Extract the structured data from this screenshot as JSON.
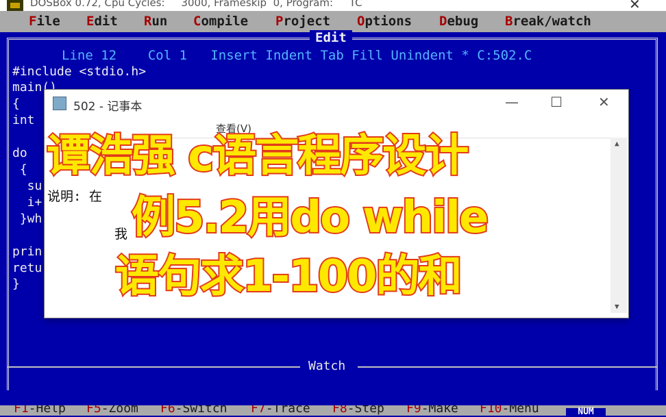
{
  "host_window": {
    "title": "DOSBox 0.72, Cpu Cycles:     3000, Frameskip  0, Program:     TC",
    "close_glyph": "✕"
  },
  "menubar": {
    "items": [
      {
        "hot": "F",
        "rest": "ile"
      },
      {
        "hot": "E",
        "rest": "dit"
      },
      {
        "hot": "R",
        "rest": "un"
      },
      {
        "hot": "C",
        "rest": "ompile"
      },
      {
        "hot": "P",
        "rest": "roject"
      },
      {
        "hot": "O",
        "rest": "ptions"
      },
      {
        "hot": "D",
        "rest": "ebug"
      },
      {
        "hot": "B",
        "rest": "reak/watch"
      }
    ]
  },
  "editor": {
    "title": "Edit",
    "status": "Line 12    Col 1   Insert Indent Tab Fill Unindent * C:502.C",
    "code_lines": [
      "#include <stdio.h>",
      "main()",
      "{",
      "int",
      "",
      "do",
      " {",
      "  su",
      "  i+",
      " }wh",
      "",
      "prin",
      "retu",
      "}"
    ],
    "watch_label": "Watch"
  },
  "fkeys": [
    {
      "key": "F1",
      "label": "-Help"
    },
    {
      "key": "F5",
      "label": "-Zoom"
    },
    {
      "key": "F6",
      "label": "-Switch"
    },
    {
      "key": "F7",
      "label": "-Trace"
    },
    {
      "key": "F8",
      "label": "-Step"
    },
    {
      "key": "F9",
      "label": "-Make"
    },
    {
      "key": "F10",
      "label": "-Menu"
    }
  ],
  "num_indicator": "NUM",
  "notepad": {
    "title": "502 - 记事本",
    "minimize_glyph": "—",
    "maximize_glyph": "☐",
    "close_glyph": "✕",
    "menu_view": "查看(V)",
    "lines": [
      "说明: 在",
      "我"
    ]
  },
  "overlay": {
    "line1": "谭浩强 c语言程序设计",
    "line2": "例5.2用do while",
    "line3": "语句求1-100的和"
  },
  "colors": {
    "dos_blue": "#0000aa",
    "menu_gray": "#aaaaaa",
    "hotkey_red": "#a80000",
    "overlay_fill": "#ffe800",
    "overlay_stroke": "#e23a1a"
  }
}
